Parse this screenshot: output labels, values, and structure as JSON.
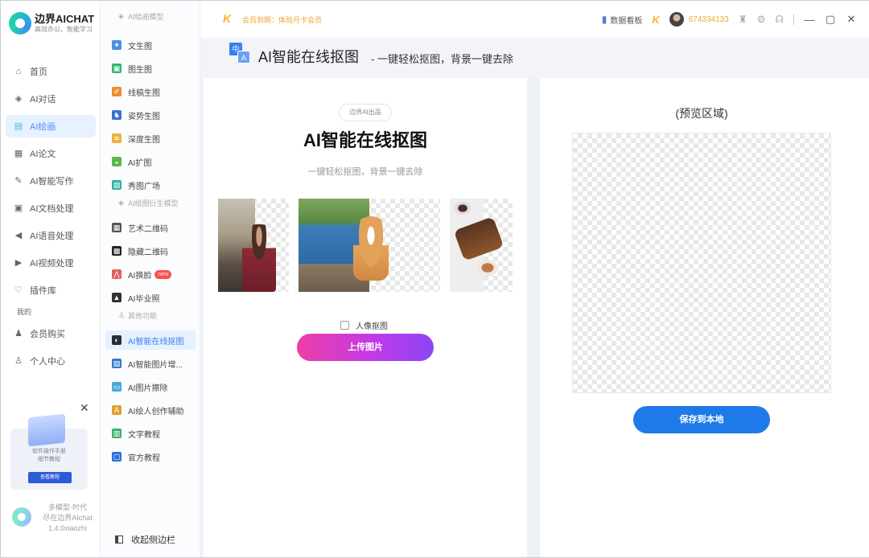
{
  "app": {
    "title": "边界AICHAT",
    "subtitle": "高效办公、智能学习"
  },
  "nav": {
    "items": [
      {
        "label": "首页",
        "icon": "home-icon",
        "glyph": "⌂"
      },
      {
        "label": "AI对话",
        "icon": "cube-icon",
        "glyph": "◈"
      },
      {
        "label": "AI绘画",
        "icon": "palette-icon",
        "glyph": "▤",
        "active": true
      },
      {
        "label": "AI论文",
        "icon": "document-icon",
        "glyph": "▦"
      },
      {
        "label": "AI智能写作",
        "icon": "pen-icon",
        "glyph": "✎"
      },
      {
        "label": "AI文档处理",
        "icon": "text-doc-icon",
        "glyph": "▣"
      },
      {
        "label": "AI语音处理",
        "icon": "speaker-icon",
        "glyph": "◀"
      },
      {
        "label": "AI视频处理",
        "icon": "video-icon",
        "glyph": "▶"
      },
      {
        "label": "插件库",
        "icon": "plugin-icon",
        "glyph": "♡"
      }
    ],
    "section_mine": "我的",
    "mine_items": [
      {
        "label": "会员购买",
        "icon": "member-icon",
        "glyph": "♟"
      },
      {
        "label": "个人中心",
        "icon": "user-icon",
        "glyph": "♙"
      }
    ]
  },
  "promo": {
    "text": "软件操作手册\n细节教程",
    "button": "查看教程",
    "close": "✕"
  },
  "footer": {
    "text": "多模型·时代\n尽在边界AIchat\n1.4.0xiaozhi"
  },
  "sub": {
    "head1": "AI绘画模型",
    "group1": [
      {
        "label": "文生图",
        "icon": "text-to-image-icon",
        "color": "#4a90e2",
        "glyph": "✦"
      },
      {
        "label": "图生图",
        "icon": "image-to-image-icon",
        "color": "#2eb872",
        "glyph": "▣"
      },
      {
        "label": "线稿生图",
        "icon": "lineart-icon",
        "color": "#f28b30",
        "glyph": "✐"
      },
      {
        "label": "姿势生图",
        "icon": "pose-icon",
        "color": "#3a6fd8",
        "glyph": "♞"
      },
      {
        "label": "深度生图",
        "icon": "depth-icon",
        "color": "#e9b23a",
        "glyph": "≋"
      },
      {
        "label": "AI扩图",
        "icon": "expand-icon",
        "color": "#5ab94a",
        "glyph": "◒"
      },
      {
        "label": "秀图广场",
        "icon": "gallery-icon",
        "color": "#2ab3a3",
        "glyph": "▧"
      }
    ],
    "head2": "AI绘图衍生模型",
    "group2": [
      {
        "label": "艺术二维码",
        "icon": "art-qr-icon",
        "color": "#555",
        "glyph": "▦"
      },
      {
        "label": "隐藏二维码",
        "icon": "hidden-qr-icon",
        "color": "#222",
        "glyph": "▩"
      },
      {
        "label": "AI换脸",
        "icon": "face-swap-icon",
        "color": "#e15f5f",
        "glyph": "⋀",
        "badge": "new"
      },
      {
        "label": "AI毕业照",
        "icon": "graduation-icon",
        "color": "#333",
        "glyph": "▲"
      }
    ],
    "head3": "其他功能",
    "group3": [
      {
        "label": "AI智能在线抠图",
        "icon": "cutout-icon",
        "color": "#2b2b3a",
        "glyph": "◐",
        "active": true
      },
      {
        "label": "AI智能图片增...",
        "icon": "enhance-icon",
        "color": "#3a78c8",
        "glyph": "▨"
      },
      {
        "label": "AI图片擦除",
        "icon": "erase-icon",
        "color": "#4aa6d8",
        "glyph": "▭"
      },
      {
        "label": "AI绘人创作辅助",
        "icon": "assist-icon",
        "color": "#e0a030",
        "glyph": "A"
      },
      {
        "label": "文字教程",
        "icon": "book-icon",
        "color": "#3cae6c",
        "glyph": "▥"
      },
      {
        "label": "官方教程",
        "icon": "monitor-icon",
        "color": "#2f6fd8",
        "glyph": "▢"
      }
    ],
    "collapse": "收起侧边栏"
  },
  "topbar": {
    "vip_mark": "K",
    "vip_text": "会员到期：体验月卡会员",
    "dashboard": "数据看板",
    "user_id": "674334133",
    "win_min": "—",
    "win_max": "▢",
    "win_close": "✕"
  },
  "title_band": {
    "title": "AI智能在线抠图",
    "subtitle": "- 一键轻松抠图，背景一键去除",
    "icon_zh": "中",
    "icon_a": "A"
  },
  "main": {
    "pill": "边界AI出品",
    "hero_title": "AI智能在线抠图",
    "hero_sub": "一键轻松抠图，背景一键去除",
    "checkbox_label": "人像抠图",
    "upload_button": "上传图片"
  },
  "preview": {
    "title": "(预览区域)",
    "save_button": "保存到本地"
  }
}
